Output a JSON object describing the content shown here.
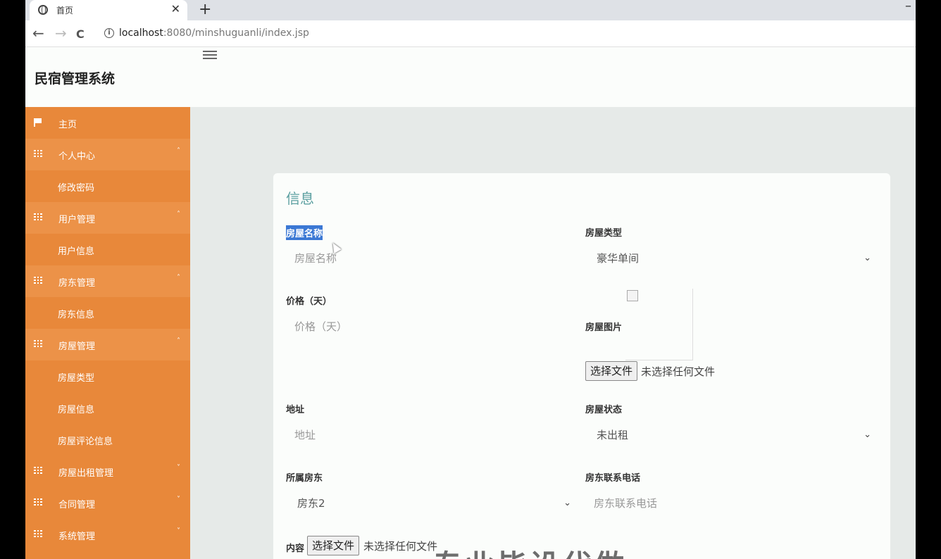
{
  "browser": {
    "tab_title": "首页",
    "tab_close": "✕",
    "new_tab": "+",
    "minimize": "–",
    "back": "←",
    "forward": "→",
    "reload": "C",
    "info": "i",
    "url_host": "localhost",
    "url_path": ":8080/minshuguanli/index.jsp"
  },
  "app": {
    "title": "民宿管理系统"
  },
  "sidebar": {
    "items": [
      {
        "label": "主页",
        "icon": "flag-icon",
        "type": "top"
      },
      {
        "label": "个人中心",
        "icon": "grid-icon",
        "type": "group",
        "caret": "˄"
      },
      {
        "label": "修改密码",
        "type": "sub"
      },
      {
        "label": "用户管理",
        "icon": "grid-icon",
        "type": "group",
        "caret": "˄"
      },
      {
        "label": "用户信息",
        "type": "sub"
      },
      {
        "label": "房东管理",
        "icon": "grid-icon",
        "type": "group",
        "caret": "˄"
      },
      {
        "label": "房东信息",
        "type": "sub"
      },
      {
        "label": "房屋管理",
        "icon": "grid-icon",
        "type": "group",
        "caret": "˄"
      },
      {
        "label": "房屋类型",
        "type": "sub"
      },
      {
        "label": "房屋信息",
        "type": "sub"
      },
      {
        "label": "房屋评论信息",
        "type": "sub"
      },
      {
        "label": "房屋出租管理",
        "icon": "grid-icon",
        "type": "top",
        "caret": "˅"
      },
      {
        "label": "合同管理",
        "icon": "grid-icon",
        "type": "top",
        "caret": "˅"
      },
      {
        "label": "系统管理",
        "icon": "grid-icon",
        "type": "top",
        "caret": "˅"
      }
    ]
  },
  "form": {
    "title": "信息",
    "house_name_label": "房屋名称",
    "house_name_placeholder": "房屋名称",
    "house_type_label": "房屋类型",
    "house_type_value": "豪华单间",
    "price_label": "价格（天）",
    "price_placeholder": "价格（天）",
    "house_image_label": "房屋图片",
    "choose_file": "选择文件",
    "no_file": "未选择任何文件",
    "address_label": "地址",
    "address_placeholder": "地址",
    "house_status_label": "房屋状态",
    "house_status_value": "未出租",
    "landlord_label": "所属房东",
    "landlord_value": "房东2",
    "landlord_phone_label": "房东联系电话",
    "landlord_phone_placeholder": "房东联系电话",
    "content_label": "内容",
    "content_choose_file": "选择文件",
    "content_no_file": "未选择任何文件",
    "chevron": "⌄"
  },
  "overlay": {
    "watermark": "专业毕设代做"
  },
  "colors": {
    "sidebar": "#e8883a",
    "sidebar_group": "#ec9248",
    "title_accent": "#5b9fa0",
    "selection": "#3b78d4"
  }
}
